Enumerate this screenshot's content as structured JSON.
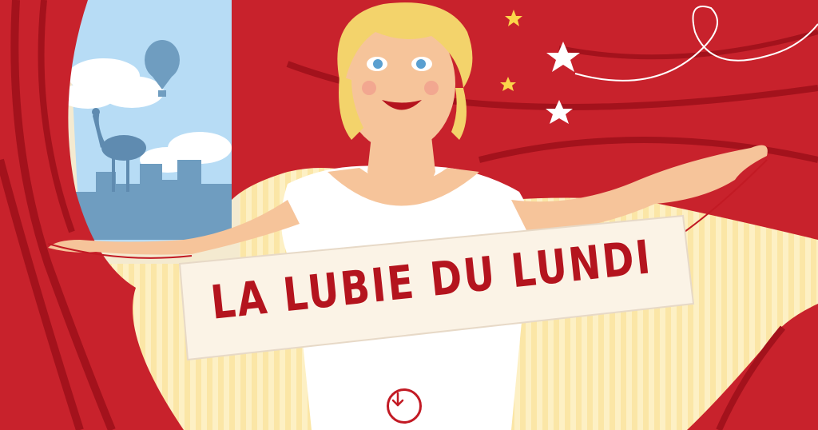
{
  "banner": {
    "title": "LA LUBIE DU LUNDI"
  },
  "scroll_button": {
    "icon": "arrow-down-icon"
  },
  "colors": {
    "curtain": "#c8222c",
    "curtain_dark": "#a3121c",
    "wall": "#fbe6a6",
    "sky": "#b7dcf5",
    "text": "#b4141e"
  }
}
